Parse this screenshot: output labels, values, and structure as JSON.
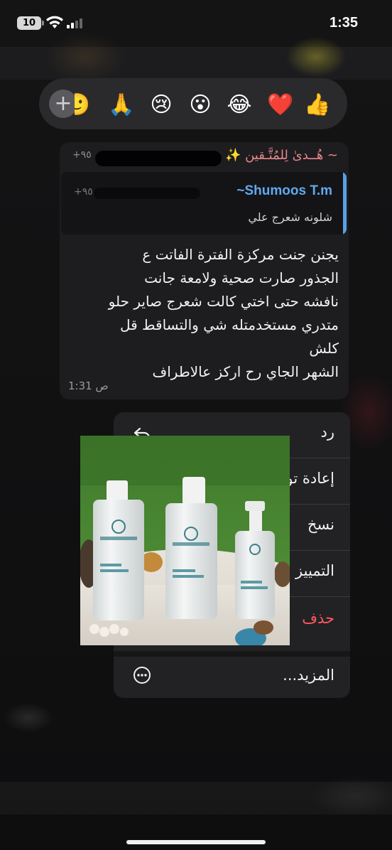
{
  "status_bar": {
    "battery": "10",
    "time": "1:35"
  },
  "reactions": {
    "add_icon": "plus-icon",
    "items": [
      {
        "emoji": "👍",
        "name": "thumbs-up"
      },
      {
        "emoji": "❤️",
        "name": "heart"
      },
      {
        "emoji": "😂",
        "name": "tears-of-joy"
      },
      {
        "emoji": "😮",
        "name": "surprised"
      },
      {
        "emoji": "😢",
        "name": "crying"
      },
      {
        "emoji": "🙏",
        "name": "praying-hands"
      },
      {
        "emoji": "🙂",
        "name": "partial-emoji"
      }
    ]
  },
  "message": {
    "sender": "~ هُــدىٰ لِلمُتَّـقين ✨",
    "sender_number": "+٩٥",
    "quote": {
      "name": "~Shumoos T.m",
      "number": "+٩٥",
      "text": "شلونه شعرج علي"
    },
    "lines": [
      "يجنن جنت مركزة الفترة الفاتت ع",
      "الجذور صارت صحية ولامعة جانت",
      "نافشه حتى اختي كالت شعرج صاير حلو",
      "متدري مستخدمتله شي والتساقط قل",
      "كلش",
      "الشهر الجاي رح اركز عالاطراف"
    ],
    "time": "1:31 ص"
  },
  "menu": {
    "items": [
      {
        "label": "رد",
        "icon": "reply-icon"
      },
      {
        "label": "إعادة توجيه",
        "icon": "forward-icon"
      },
      {
        "label": "نسخ",
        "icon": "copy-icon"
      },
      {
        "label": "التمييز بنجمة",
        "icon": "star-icon"
      },
      {
        "label": "حذف",
        "icon": "trash-icon"
      }
    ],
    "more_label": "المزيد...",
    "more_icon": "more-icon"
  },
  "photo": {
    "brand": "NOUVELIFE",
    "products": [
      "Hair Restorative Shampoo",
      "Hair Restorative Conditioner Cream",
      "Hair Restorative Serum"
    ]
  },
  "colors": {
    "accent_blue": "#60aaf0",
    "sender_pink": "#e8878a",
    "danger_red": "#ff5a60"
  }
}
